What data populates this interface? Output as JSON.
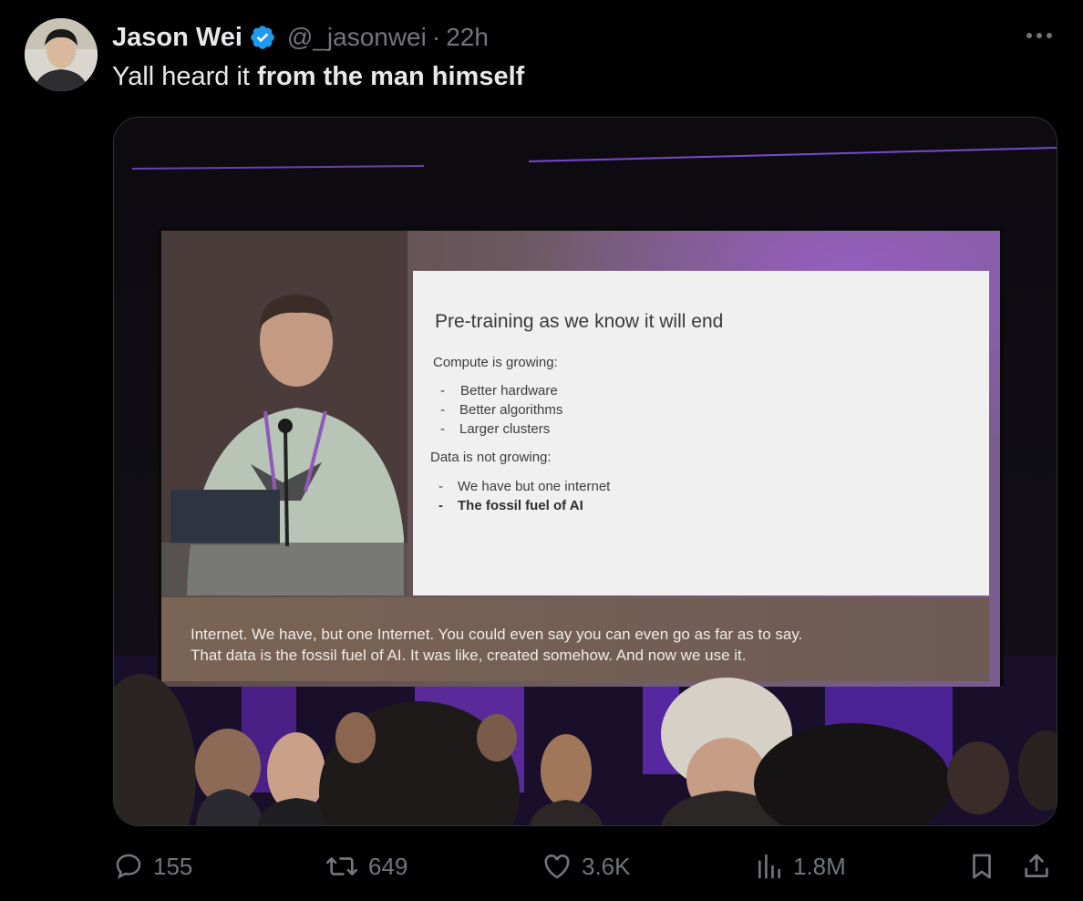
{
  "author": {
    "name": "Jason Wei",
    "handle": "@_jasonwei",
    "separator": "·",
    "time": "22h",
    "avatar_icon": "profile-photo",
    "verified_icon": "verified-badge-icon",
    "verified_color": "#1d9bf0"
  },
  "tweet": {
    "text_plain": "Yall heard it ",
    "text_bold": "from the man himself"
  },
  "more_icon": "more-dots-icon",
  "media": {
    "slide": {
      "title": "Pre-training as we know it will end",
      "section1": "Compute is growing:",
      "bullets1": [
        "Better hardware",
        "Better algorithms",
        "Larger clusters"
      ],
      "section2": "Data is not growing:",
      "bullets2": [
        "We have but one internet",
        "The fossil fuel of AI"
      ],
      "bullet_marker": "-"
    },
    "caption": {
      "line1": "Internet. We have, but one Internet. You could even say you can even go as far as to say.",
      "line2": "That data is the fossil fuel of AI. It was like, created somehow. And now we use it."
    }
  },
  "actions": {
    "replies": "155",
    "reposts": "649",
    "likes": "3.6K",
    "views": "1.8M",
    "reply_icon": "reply-icon",
    "repost_icon": "repost-icon",
    "like_icon": "heart-icon",
    "views_icon": "views-bars-icon",
    "bookmark_icon": "bookmark-icon",
    "share_icon": "share-icon",
    "icon_color": "#71767b"
  }
}
